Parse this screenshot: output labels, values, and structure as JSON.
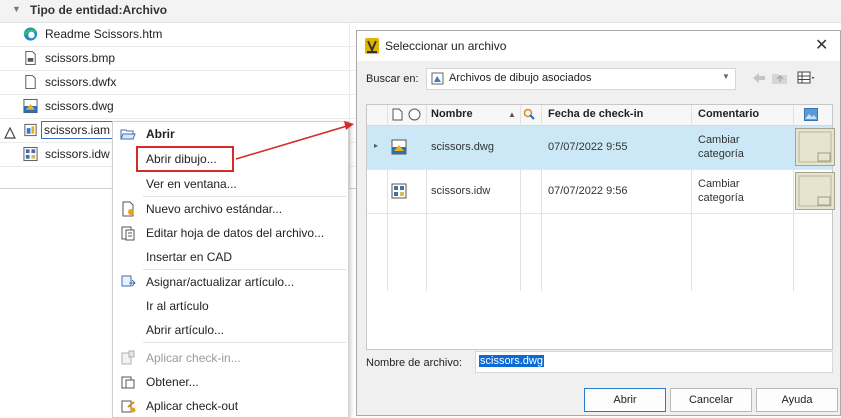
{
  "tree": {
    "group_label": "Tipo de entidad:Archivo",
    "items": [
      {
        "label": "Readme Scissors.htm",
        "icon": "edge-icon"
      },
      {
        "label": "scissors.bmp",
        "icon": "bitmap-file-icon"
      },
      {
        "label": "scissors.dwfx",
        "icon": "blank-file-icon"
      },
      {
        "label": "scissors.dwg",
        "icon": "dwg-file-icon"
      },
      {
        "label": "scissors.iam",
        "icon": "assembly-file-icon"
      },
      {
        "label": "scissors.idw",
        "icon": "drawing-file-icon"
      }
    ]
  },
  "context_menu": {
    "items": [
      {
        "label": "Abrir"
      },
      {
        "label": "Abrir dibujo..."
      },
      {
        "label": "Ver en ventana..."
      },
      {
        "label": "Nuevo archivo estándar..."
      },
      {
        "label": "Editar hoja de datos del archivo..."
      },
      {
        "label": "Insertar en CAD"
      },
      {
        "label": "Asignar/actualizar artículo..."
      },
      {
        "label": "Ir al artículo"
      },
      {
        "label": "Abrir artículo..."
      },
      {
        "label": "Aplicar check-in..."
      },
      {
        "label": "Obtener..."
      },
      {
        "label": "Aplicar check-out"
      }
    ]
  },
  "dialog": {
    "title": "Seleccionar un archivo",
    "look_in_label": "Buscar en:",
    "look_in_value": "Archivos de dibujo asociados",
    "columns": {
      "name": "Nombre",
      "checkin_date": "Fecha de check-in",
      "comment": "Comentario"
    },
    "rows": [
      {
        "name": "scissors.dwg",
        "checkin_date": "07/07/2022 9:55",
        "comment_line1": "Cambiar",
        "comment_line2": "categoría"
      },
      {
        "name": "scissors.idw",
        "checkin_date": "07/07/2022 9:56",
        "comment_line1": "Cambiar",
        "comment_line2": "categoría"
      }
    ],
    "filename_label": "Nombre de archivo:",
    "filename_value": "scissors.dwg",
    "buttons": {
      "open": "Abrir",
      "cancel": "Cancelar",
      "help": "Ayuda"
    }
  },
  "colors": {
    "highlight_box": "#d42a2a",
    "selected_row": "#cce8f6",
    "selection_text_bg": "#0a6bd6",
    "vault_logo": "#e2b400"
  }
}
